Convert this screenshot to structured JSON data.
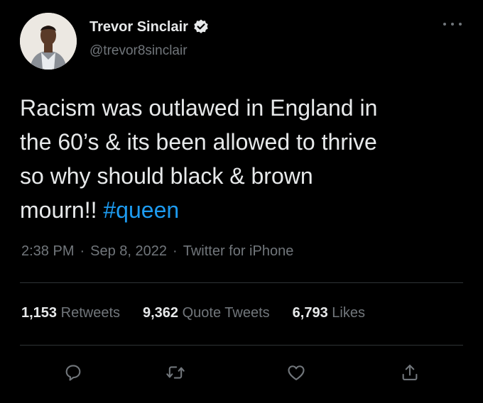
{
  "user": {
    "display_name": "Trevor Sinclair",
    "handle": "@trevor8sinclair",
    "verified": true
  },
  "tweet": {
    "text": "Racism was outlawed in England in\nthe 60’s & its been allowed to thrive\nso why should black & brown\nmourn!! ",
    "hashtag": "#queen",
    "time": "2:38 PM",
    "date": "Sep 8, 2022",
    "source": "Twitter for iPhone",
    "separator": "·"
  },
  "stats": {
    "retweets_count": "1,153",
    "retweets_label": "Retweets",
    "quotes_count": "9,362",
    "quotes_label": "Quote Tweets",
    "likes_count": "6,793",
    "likes_label": "Likes"
  },
  "icons": {
    "more": "more-icon",
    "verified": "verified-badge-icon",
    "reply": "reply-icon",
    "retweet": "retweet-icon",
    "like": "like-icon",
    "share": "share-icon"
  },
  "colors": {
    "background": "#000000",
    "text": "#e7e9ea",
    "muted": "#71767b",
    "accent": "#1d9bf0",
    "divider": "#2f3336"
  }
}
